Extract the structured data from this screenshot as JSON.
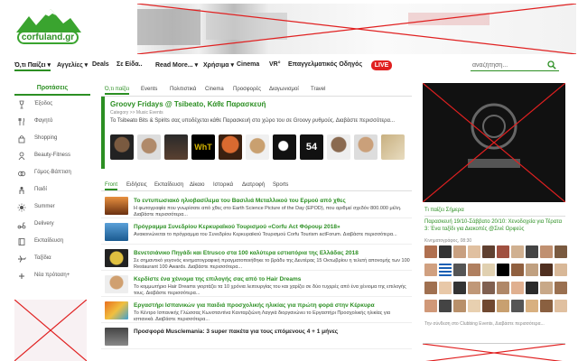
{
  "logo": {
    "text": "corfuland.gr"
  },
  "nav": {
    "items": [
      {
        "label": "Ό,τι Παίζει ▾"
      },
      {
        "label": "Αγγελίες ▾"
      },
      {
        "label": "Deals"
      },
      {
        "label": "Σε Είδα.."
      },
      {
        "label": "Read More... ▾"
      },
      {
        "label": "Χρήσιμα ▾"
      },
      {
        "label": "Cinema"
      },
      {
        "label": "VR°"
      },
      {
        "label": "Επαγγελματικός Οδηγός"
      }
    ],
    "live_label": "LIVE",
    "search_placeholder": "αναζήτηση..."
  },
  "sidebar": {
    "title": "Προτάσεις",
    "items": [
      {
        "label": "Έξοδος",
        "icon": "wine-glass-icon"
      },
      {
        "label": "Φαγητό",
        "icon": "fork-knife-icon"
      },
      {
        "label": "Shopping",
        "icon": "shopping-bag-icon"
      },
      {
        "label": "Beauty-Fitness",
        "icon": "beauty-icon"
      },
      {
        "label": "Γάμος-Βάπτιση",
        "icon": "rings-icon"
      },
      {
        "label": "Παιδί",
        "icon": "child-icon"
      },
      {
        "label": "Summer",
        "icon": "sun-icon"
      },
      {
        "label": "Delivery",
        "icon": "scooter-icon"
      },
      {
        "label": "Εκπαίδευση",
        "icon": "book-icon"
      },
      {
        "label": "Ταξίδια",
        "icon": "plane-icon"
      },
      {
        "label": "Νέα πρόταση+",
        "icon": "plus-icon"
      }
    ]
  },
  "events": {
    "tabs": [
      "Ό,τι παίζει",
      "Events",
      "Πολιτιστικά",
      "Cinema",
      "Προσφορές",
      "Διαγωνισμοί",
      "Travel"
    ],
    "featured": {
      "title": "Groovy Fridays @ Tsibeato, Κάθε Παρασκευή",
      "category": "Category >> Music Events",
      "description": "To Tsibeato Bits & Spirits σας υποδέχεται κάθε Παρασκευή στο χώρο του σε Groovy ρυθμούς. Διαβάστε περισσότερα..."
    },
    "thumb_labels": [
      "WhT",
      "54"
    ]
  },
  "news": {
    "tabs": [
      "Front",
      "Ειδήσεις",
      "Εκπαίδευση",
      "Δίκαιο",
      "Ιστορικά",
      "Διατροφή",
      "Sports"
    ],
    "items": [
      {
        "title": "Το εντυπωσιακό ηλιοβασίλεμα του Βασιλιά Μεταλλικού του Ερμού από χθες",
        "desc": "Η φωτογραφία που γνωρίσατε από χθες στο Earth Science Picture of the Day (EPOD), που αριθμεί σχεδόν 800.000 μέλη. Διαβάστε περισσότερα..."
      },
      {
        "title": "Πρόγραμμα Συνεδρίου Κερκυραϊκού Τουρισμού «Corfu Act Φόρουμ 2018»",
        "desc": "Ανακοινώνεται το πρόγραμμα του Συνεδρίου Κερκυραϊκού Τουρισμού Corfu Tourism actForum. Διαβάστε περισσότερα..."
      },
      {
        "title": "Βενετσιάνικο Πηγάδι και Etrusco στα 100 καλύτερα εστιατόρια της Ελλάδας 2018",
        "desc": "Σε σημαντικό γεγονός κινηματογραφική πραγματοποιήθηκε το βράδυ της Δευτέρας 15 Οκτωβρίου η τελετή απονομής των 100 Restaurant 100 Awards. Διαβάστε περισσότερα..."
      },
      {
        "title": "Κερδίστε ένα χένιομα της επιλογής σας από το Hair Dreams",
        "desc": "Το κομμωτήριο Hair Dreams γιορτάζει τα 10 χρόνια λειτουργίας του και χαρίζει σε δύο τυχερές από ένα χένιομα της επιλογής τους. Διαβάστε περισσότερα..."
      },
      {
        "title": "Εργαστήρι Ισπανικών για παιδιά προσχολικής ηλικίας για πρώτη φορά στην Κέρκυρα",
        "desc": "Το Κέντρο Ισπανικής Γλώσσας Κωνσταντίνα Κανταρζιώνη Λαγγιά διοργανώνει το Εργαστήρι Προσχολικής ηλικίας για ισπανικά. Διαβάστε περισσότερα..."
      },
      {
        "title": "Προσφορά Musclemania: 3 super πακέτα για τους επόμενους 4 + 1 μήνες",
        "desc": ""
      }
    ]
  },
  "right": {
    "today_title": "Τι παίζει Σήμερα",
    "today_text": "Παρασκευή 19/10-Σάββατο 20/10: Χενοδοχεία για Τέρατα 3: Ένα ταξίδι για Διακοπές @Σινέ Ορφεύς",
    "meta": "Κινηματογράφος, 08:30",
    "footer": "Την σύνδεση στο Clubbing Events, Διαβάστε περισσότερα..."
  }
}
